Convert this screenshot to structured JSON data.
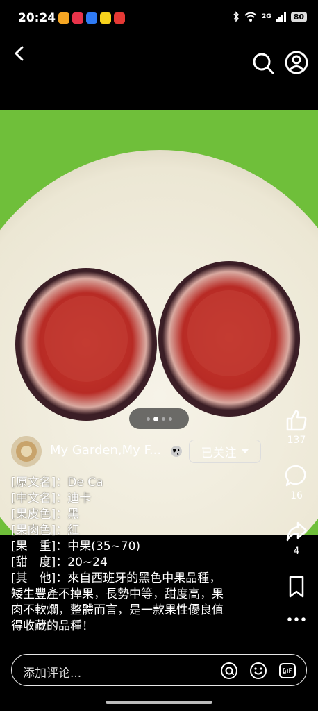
{
  "status_bar": {
    "time": "20:24",
    "network": "2G",
    "battery": "80"
  },
  "post": {
    "author": "My Garden,My F...",
    "follow_label": "已关注",
    "pager": {
      "count": 4,
      "active": 1
    },
    "caption_lines": [
      "[原文名]：De Ca",
      "[中文名]：迪卡",
      "[果皮色]：黑",
      "[果肉色]：紅",
      "[果　重]：中果(35~70)",
      "[甜　度]：20~24",
      "[其　他]：來自西班牙的黑色中果品種，",
      "矮生豐產不掉果，長勢中等，甜度高，果",
      "肉不軟爛，整體而言，是一款果性優良值",
      "得收藏的品種！"
    ]
  },
  "actions": {
    "likes": "137",
    "comments": "16",
    "shares": "4"
  },
  "comment_bar": {
    "placeholder": "添加评论..."
  },
  "colors": {
    "plate_green": "#6fbf3a",
    "plate_white": "#f3efe2",
    "fig_red": "#b82b25"
  }
}
